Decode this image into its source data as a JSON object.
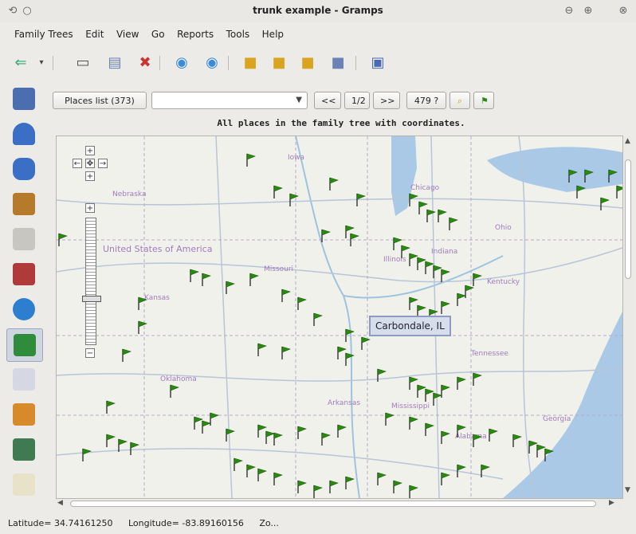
{
  "window": {
    "title": "trunk example - Gramps"
  },
  "menu": [
    "Family Trees",
    "Edit",
    "View",
    "Go",
    "Reports",
    "Tools",
    "Help"
  ],
  "nav": {
    "places_label": "Places list (373)",
    "filter_value": "",
    "prev_label": "<<",
    "page_label": "1/2",
    "next_label": ">>",
    "count_label": "479 ?"
  },
  "map": {
    "caption": "All places in the family tree with coordinates.",
    "tooltip": "Carbondale, IL",
    "labels": [
      "United States of America",
      "Chicago",
      "Missouri",
      "Illinois",
      "Indiana",
      "Ohio",
      "Kentucky",
      "Tennessee",
      "Mississippi",
      "Alabama",
      "Georgia",
      "Kansas",
      "Oklahoma",
      "Arkansas",
      "Iowa",
      "Nebraska"
    ]
  },
  "zoom": {
    "up": "+",
    "down": "+",
    "left": "←",
    "right": "→",
    "in": "+",
    "out": "−"
  },
  "status": {
    "latitude": "Latitude= 34.74161250",
    "longitude": "Longitude= -83.89160156",
    "zoom": "Zo..."
  },
  "colors": {
    "pin": "#2a8a10",
    "water": "#9ec3e0",
    "road": "#b8c4d8"
  }
}
